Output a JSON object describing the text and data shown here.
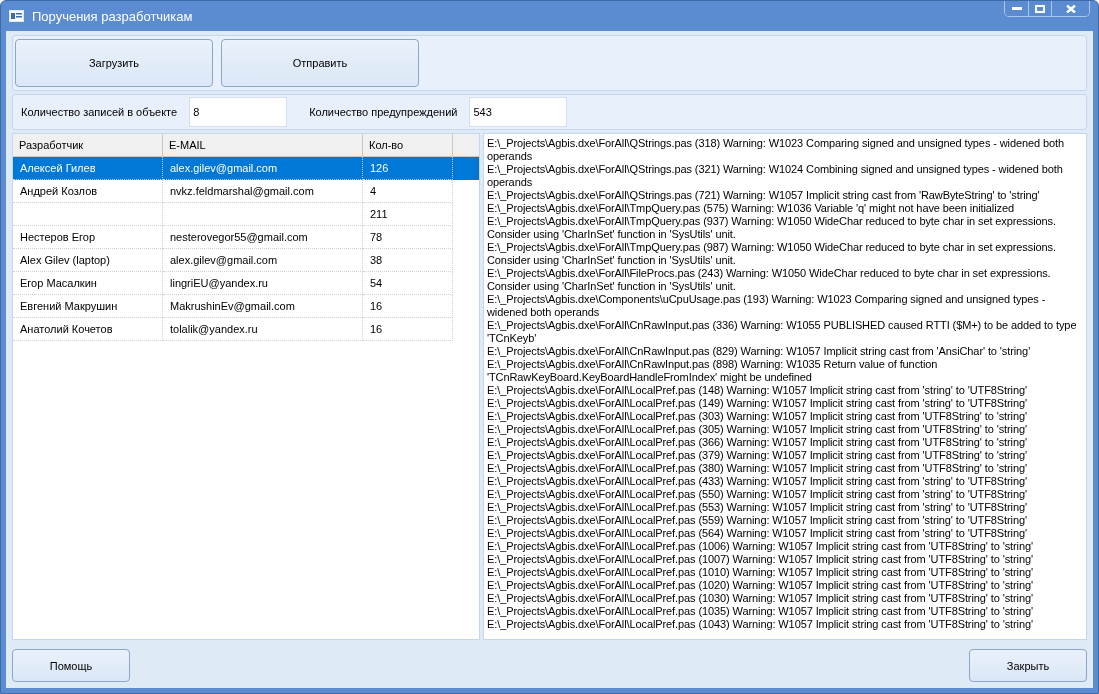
{
  "window": {
    "title": "Поручения разработчикам"
  },
  "top_buttons": [
    "Загрузить",
    "Отправить"
  ],
  "stats": [
    {
      "label": "Количество записей в объекте",
      "value": "8"
    },
    {
      "label": "Количество предупреждений",
      "value": "543"
    }
  ],
  "table": {
    "columns": [
      "Разработчик",
      "E-MAIL",
      "Кол-во"
    ],
    "rows": [
      {
        "developer": "Алексей Гилев",
        "email": "alex.gilev@gmail.com",
        "count": "126",
        "selected": true
      },
      {
        "developer": "Андрей Козлов",
        "email": "nvkz.feldmarshal@gmail.com",
        "count": "4",
        "selected": false
      },
      {
        "developer": "",
        "email": "",
        "count": "211",
        "selected": false
      },
      {
        "developer": "Нестеров Егор",
        "email": "nesterovegor55@gmail.com",
        "count": "78",
        "selected": false
      },
      {
        "developer": "Alex Gilev (laptop)",
        "email": "alex.gilev@gmail.com",
        "count": "38",
        "selected": false
      },
      {
        "developer": "Егор Масалкин",
        "email": "lingriEU@yandex.ru",
        "count": "54",
        "selected": false
      },
      {
        "developer": "Евгений Макрушин",
        "email": "MakrushinEv@gmail.com",
        "count": "16",
        "selected": false
      },
      {
        "developer": "Анатолий Кочетов",
        "email": "tolalik@yandex.ru",
        "count": "16",
        "selected": false
      }
    ]
  },
  "log": [
    "E:\\_Projects\\Agbis.dxe\\ForAll\\QStrings.pas (318) Warning: W1023 Comparing signed and unsigned types - widened both operands",
    "E:\\_Projects\\Agbis.dxe\\ForAll\\QStrings.pas (321) Warning: W1024 Combining signed and unsigned types - widened both operands",
    "E:\\_Projects\\Agbis.dxe\\ForAll\\QStrings.pas (721) Warning: W1057 Implicit string cast from 'RawByteString' to 'string'",
    "E:\\_Projects\\Agbis.dxe\\ForAll\\TmpQuery.pas (575) Warning: W1036 Variable 'q' might not have been initialized",
    "E:\\_Projects\\Agbis.dxe\\ForAll\\TmpQuery.pas (937) Warning: W1050 WideChar reduced to byte char in set expressions.  Consider using 'CharInSet' function in 'SysUtils' unit.",
    "E:\\_Projects\\Agbis.dxe\\ForAll\\TmpQuery.pas (987) Warning: W1050 WideChar reduced to byte char in set expressions.  Consider using 'CharInSet' function in 'SysUtils' unit.",
    "E:\\_Projects\\Agbis.dxe\\ForAll\\FileProcs.pas (243) Warning: W1050 WideChar reduced to byte char in set expressions.  Consider using 'CharInSet' function in 'SysUtils' unit.",
    "E:\\_Projects\\Agbis.dxe\\Components\\uCpuUsage.pas (193) Warning: W1023 Comparing signed and unsigned types - widened both operands",
    "E:\\_Projects\\Agbis.dxe\\ForAll\\CnRawInput.pas (336) Warning: W1055 PUBLISHED caused RTTI ($M+) to be added to type 'TCnKeyb'",
    "E:\\_Projects\\Agbis.dxe\\ForAll\\CnRawInput.pas (829) Warning: W1057 Implicit string cast from 'AnsiChar' to 'string'",
    "E:\\_Projects\\Agbis.dxe\\ForAll\\CnRawInput.pas (898) Warning: W1035 Return value of function 'TCnRawKeyBoard.KeyBoardHandleFromIndex' might be undefined",
    "E:\\_Projects\\Agbis.dxe\\ForAll\\LocalPref.pas (148) Warning: W1057 Implicit string cast from 'string' to 'UTF8String'",
    "E:\\_Projects\\Agbis.dxe\\ForAll\\LocalPref.pas (149) Warning: W1057 Implicit string cast from 'string' to 'UTF8String'",
    "E:\\_Projects\\Agbis.dxe\\ForAll\\LocalPref.pas (303) Warning: W1057 Implicit string cast from 'UTF8String' to 'string'",
    "E:\\_Projects\\Agbis.dxe\\ForAll\\LocalPref.pas (305) Warning: W1057 Implicit string cast from 'UTF8String' to 'string'",
    "E:\\_Projects\\Agbis.dxe\\ForAll\\LocalPref.pas (366) Warning: W1057 Implicit string cast from 'UTF8String' to 'string'",
    "E:\\_Projects\\Agbis.dxe\\ForAll\\LocalPref.pas (379) Warning: W1057 Implicit string cast from 'UTF8String' to 'string'",
    "E:\\_Projects\\Agbis.dxe\\ForAll\\LocalPref.pas (380) Warning: W1057 Implicit string cast from 'UTF8String' to 'string'",
    "E:\\_Projects\\Agbis.dxe\\ForAll\\LocalPref.pas (433) Warning: W1057 Implicit string cast from 'string' to 'UTF8String'",
    "E:\\_Projects\\Agbis.dxe\\ForAll\\LocalPref.pas (550) Warning: W1057 Implicit string cast from 'string' to 'UTF8String'",
    "E:\\_Projects\\Agbis.dxe\\ForAll\\LocalPref.pas (553) Warning: W1057 Implicit string cast from 'string' to 'UTF8String'",
    "E:\\_Projects\\Agbis.dxe\\ForAll\\LocalPref.pas (559) Warning: W1057 Implicit string cast from 'string' to 'UTF8String'",
    "E:\\_Projects\\Agbis.dxe\\ForAll\\LocalPref.pas (564) Warning: W1057 Implicit string cast from 'string' to 'UTF8String'",
    "E:\\_Projects\\Agbis.dxe\\ForAll\\LocalPref.pas (1006) Warning: W1057 Implicit string cast from 'UTF8String' to 'string'",
    "E:\\_Projects\\Agbis.dxe\\ForAll\\LocalPref.pas (1007) Warning: W1057 Implicit string cast from 'UTF8String' to 'string'",
    "E:\\_Projects\\Agbis.dxe\\ForAll\\LocalPref.pas (1010) Warning: W1057 Implicit string cast from 'UTF8String' to 'string'",
    "E:\\_Projects\\Agbis.dxe\\ForAll\\LocalPref.pas (1020) Warning: W1057 Implicit string cast from 'UTF8String' to 'string'",
    "E:\\_Projects\\Agbis.dxe\\ForAll\\LocalPref.pas (1030) Warning: W1057 Implicit string cast from 'UTF8String' to 'string'",
    "E:\\_Projects\\Agbis.dxe\\ForAll\\LocalPref.pas (1035) Warning: W1057 Implicit string cast from 'UTF8String' to 'string'",
    "E:\\_Projects\\Agbis.dxe\\ForAll\\LocalPref.pas (1043) Warning: W1057 Implicit string cast from 'UTF8String' to 'string'"
  ],
  "bottom_buttons": [
    "Помощь",
    "Закрыть"
  ]
}
